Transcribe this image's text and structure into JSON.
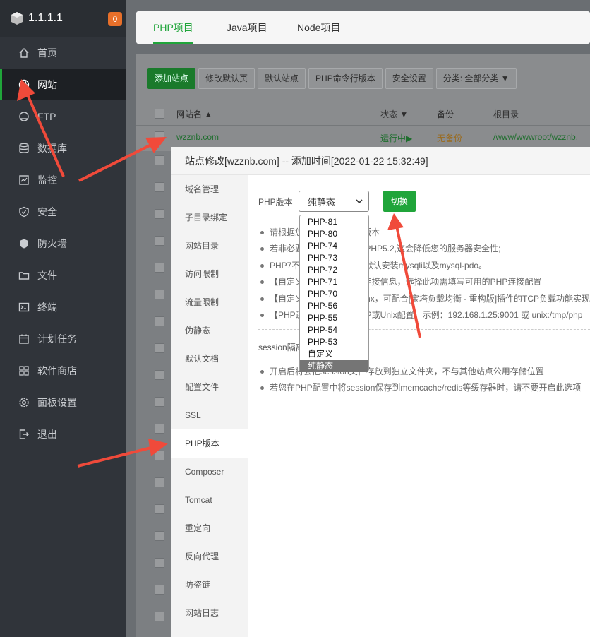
{
  "sidebar": {
    "ip": "1.1.1.1",
    "badge": "0",
    "items": [
      {
        "label": "首页",
        "icon": "home-icon"
      },
      {
        "label": "网站",
        "icon": "globe-icon"
      },
      {
        "label": "FTP",
        "icon": "ftp-icon"
      },
      {
        "label": "数据库",
        "icon": "database-icon"
      },
      {
        "label": "监控",
        "icon": "monitor-icon"
      },
      {
        "label": "安全",
        "icon": "shield-icon"
      },
      {
        "label": "防火墙",
        "icon": "firewall-icon"
      },
      {
        "label": "文件",
        "icon": "folder-icon"
      },
      {
        "label": "终端",
        "icon": "terminal-icon"
      },
      {
        "label": "计划任务",
        "icon": "calendar-icon"
      },
      {
        "label": "软件商店",
        "icon": "apps-icon"
      },
      {
        "label": "面板设置",
        "icon": "gear-icon"
      },
      {
        "label": "退出",
        "icon": "logout-icon"
      }
    ]
  },
  "tabs": [
    "PHP项目",
    "Java项目",
    "Node项目"
  ],
  "toolbar": {
    "add": "添加站点",
    "edit_default_page": "修改默认页",
    "default_site": "默认站点",
    "php_cli": "PHP命令行版本",
    "security": "安全设置",
    "category": "分类: 全部分类"
  },
  "table": {
    "headers": {
      "name": "网站名",
      "status": "状态",
      "backup": "备份",
      "root": "根目录"
    },
    "row": {
      "name": "wzznb.com",
      "status": "运行中▶",
      "backup": "无备份",
      "root": "/www/wwwroot/wzznb."
    }
  },
  "modal": {
    "title": "站点修改[wzznb.com] -- 添加时间[2022-01-22 15:32:49]",
    "side_items": [
      "域名管理",
      "子目录绑定",
      "网站目录",
      "访问限制",
      "流量限制",
      "伪静态",
      "默认文档",
      "配置文件",
      "SSL",
      "PHP版本",
      "Composer",
      "Tomcat",
      "重定向",
      "反向代理",
      "防盗链",
      "网站日志"
    ],
    "php_label": "PHP版本",
    "php_selected": "纯静态",
    "switch_label": "切换",
    "tips": [
      "请根据您的程序需求选择版本",
      "若非必要,请尽量不要使用PHP5.2,这会降低您的服务器安全性;",
      "PHP7不支持mysql扩展，默认安装mysqli以及mysql-pdo。",
      "【自定义】可自定义PHP连接信息，选择此项需填写可用的PHP连接配置",
      "【自定义】当前仅支持nginx，可配合[宝塔负载均衡 - 重构版]插件的TCP负载功能实现",
      "【PHP连接配置】支持TCP或Unix配置，示例：192.168.1.25:9001 或 unix:/tmp/php"
    ],
    "session_label": "session隔离",
    "tips2": [
      "开启后将会把session文件存放到独立文件夹，不与其他站点公用存储位置",
      "若您在PHP配置中将session保存到memcache/redis等缓存器时，请不要开启此选项"
    ]
  },
  "dropdown": {
    "options": [
      "PHP-81",
      "PHP-80",
      "PHP-74",
      "PHP-73",
      "PHP-72",
      "PHP-71",
      "PHP-70",
      "PHP-56",
      "PHP-55",
      "PHP-54",
      "PHP-53",
      "自定义",
      "纯静态"
    ],
    "selected_index": 12
  },
  "colors": {
    "accent": "#20a53a",
    "annotation": "#f04a3a"
  }
}
